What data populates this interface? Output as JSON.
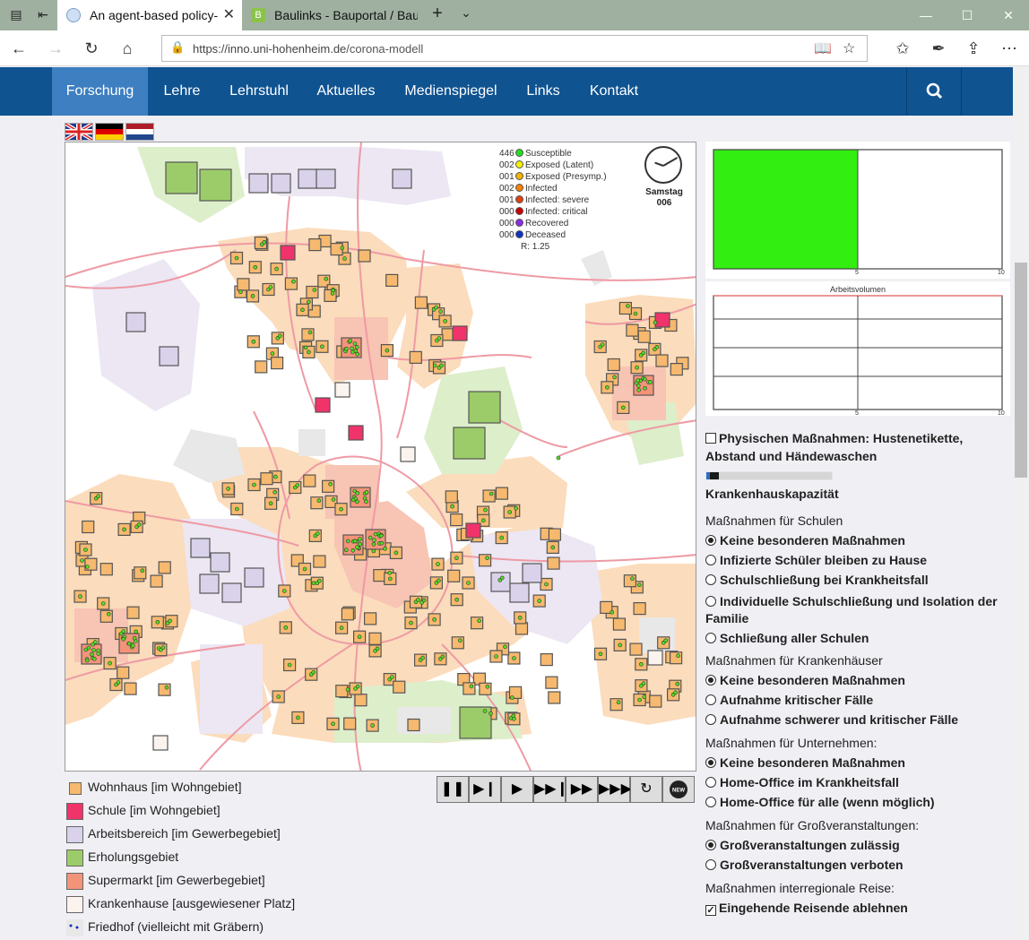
{
  "browser": {
    "tabs": [
      {
        "title": "An agent-based policy-"
      },
      {
        "title": "Baulinks - Bauportal / Baum"
      }
    ],
    "url_host": "https://inno.uni-hohenheim.de",
    "url_path": "/corona-modell"
  },
  "site_nav": {
    "items": [
      "Forschung",
      "Lehre",
      "Lehrstuhl",
      "Aktuelles",
      "Medienspiegel",
      "Links",
      "Kontakt"
    ],
    "active": "Forschung"
  },
  "simulation": {
    "status": [
      {
        "count": "446",
        "label": "Susceptible",
        "color": "#22dd22"
      },
      {
        "count": "002",
        "label": "Exposed (Latent)",
        "color": "#f2f200"
      },
      {
        "count": "001",
        "label": "Exposed (Presymp.)",
        "color": "#f5b400"
      },
      {
        "count": "002",
        "label": "Infected",
        "color": "#f57f00"
      },
      {
        "count": "001",
        "label": "Infected: severe",
        "color": "#e04010"
      },
      {
        "count": "000",
        "label": "Infected: critical",
        "color": "#cc0000"
      },
      {
        "count": "000",
        "label": "Recovered",
        "color": "#8a2be2"
      },
      {
        "count": "000",
        "label": "Deceased",
        "color": "#1030c0"
      }
    ],
    "r_value": "R: 1.25",
    "day_name": "Samstag",
    "day_number": "006"
  },
  "legend": [
    {
      "label": "Wohnhaus [im Wohngebiet]",
      "color": "#f6b96f"
    },
    {
      "label": "Schule [im Wohngebiet]",
      "color": "#f0336a"
    },
    {
      "label": "Arbeitsbereich [im Gewerbegebiet]",
      "color": "#d9d2ea"
    },
    {
      "label": "Erholungsgebiet",
      "color": "#9ccc6a"
    },
    {
      "label": "Supermarkt [im Gewerbegebiet]",
      "color": "#f39478"
    },
    {
      "label": "Krankenhause [ausgewiesener Platz]",
      "color": "#fbf3ee"
    },
    {
      "label": "Friedhof (vielleicht mit Gräbern)",
      "color": "#e8e8e8"
    }
  ],
  "chart_data": [
    {
      "type": "bar",
      "title": "",
      "x_ticks": [
        "5",
        "10"
      ],
      "xlim": [
        0,
        10
      ],
      "values": [
        5
      ]
    },
    {
      "type": "line",
      "title": "Arbeitsvolumen",
      "x_ticks": [
        "5",
        "10"
      ],
      "xlim": [
        0,
        10
      ]
    }
  ],
  "panel": {
    "physical_measures": "Physischen Maßnahmen: Hustenetikette, Abstand und Händewaschen",
    "capacity_label": "Krankenhauskapazität",
    "capacity_used": 0.1,
    "schools_heading": "Maßnahmen für Schulen",
    "schools_options": [
      "Keine besonderen Maßnahmen",
      "Infizierte Schüler bleiben zu Hause",
      "Schulschließung bei Krankheitsfall",
      "Individuelle Schulschließung und Isolation der Familie",
      "Schließung aller Schulen"
    ],
    "hospitals_heading": "Maßnahmen für Krankenhäuser",
    "hospitals_options": [
      "Keine besonderen Maßnahmen",
      "Aufnahme kritischer Fälle",
      "Aufnahme schwerer und kritischer Fälle"
    ],
    "companies_heading": "Maßnahmen für Unternehmen:",
    "companies_options": [
      "Keine besonderen Maßnahmen",
      "Home-Office im Krankheitsfall",
      "Home-Office für alle (wenn möglich)"
    ],
    "events_heading": "Maßnahmen für Großveranstaltungen:",
    "events_options": [
      "Großveranstaltungen zulässig",
      "Großveranstaltungen verboten"
    ],
    "travel_heading": "Maßnahmen interregionale Reise:",
    "travel_option": "Eingehende Reisende ablehnen"
  }
}
